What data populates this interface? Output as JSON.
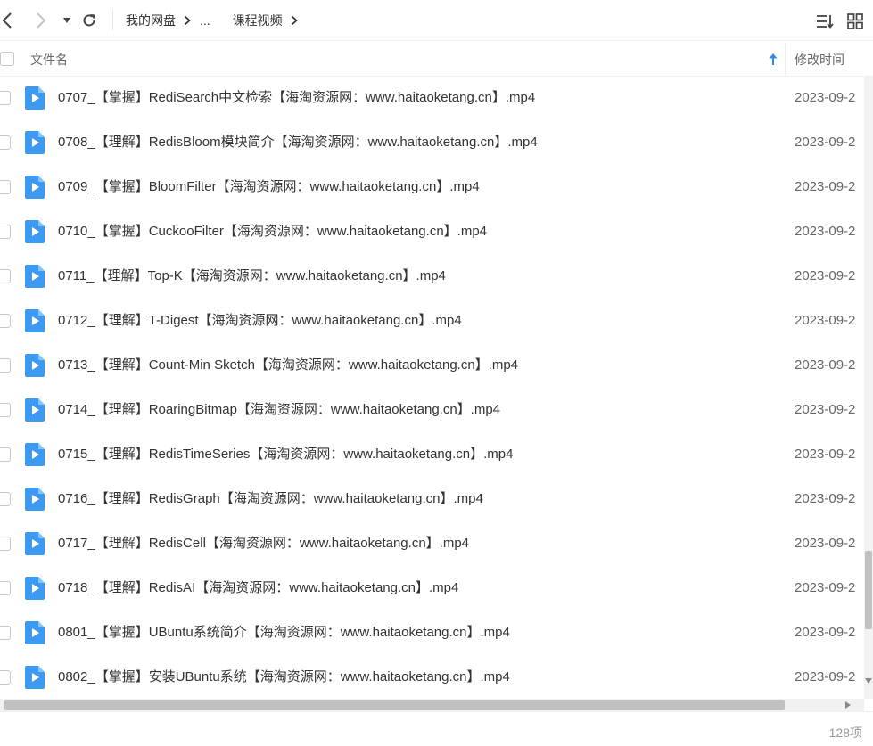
{
  "toolbar": {
    "icons": {
      "back": "chevron-left-icon",
      "forward": "chevron-right-icon",
      "history": "caret-down-icon",
      "refresh": "refresh-icon",
      "sort": "sort-list-icon",
      "view": "grid-view-icon"
    },
    "breadcrumb": {
      "root": "我的网盘",
      "ellipsis": "...",
      "current": "课程视频"
    }
  },
  "header": {
    "name_label": "文件名",
    "time_label": "修改时间",
    "sort_icon": "arrow-up-icon"
  },
  "files": [
    {
      "name": "0707_【掌握】RediSearch中文检索【海淘资源网：www.haitaoketang.cn】.mp4",
      "time": "2023-09-2"
    },
    {
      "name": "0708_【理解】RedisBloom模块简介【海淘资源网：www.haitaoketang.cn】.mp4",
      "time": "2023-09-2"
    },
    {
      "name": "0709_【掌握】BloomFilter【海淘资源网：www.haitaoketang.cn】.mp4",
      "time": "2023-09-2"
    },
    {
      "name": "0710_【掌握】CuckooFilter【海淘资源网：www.haitaoketang.cn】.mp4",
      "time": "2023-09-2"
    },
    {
      "name": "0711_【理解】Top-K【海淘资源网：www.haitaoketang.cn】.mp4",
      "time": "2023-09-2"
    },
    {
      "name": "0712_【理解】T-Digest【海淘资源网：www.haitaoketang.cn】.mp4",
      "time": "2023-09-2"
    },
    {
      "name": "0713_【理解】Count-Min Sketch【海淘资源网：www.haitaoketang.cn】.mp4",
      "time": "2023-09-2"
    },
    {
      "name": "0714_【理解】RoaringBitmap【海淘资源网：www.haitaoketang.cn】.mp4",
      "time": "2023-09-2"
    },
    {
      "name": "0715_【理解】RedisTimeSeries【海淘资源网：www.haitaoketang.cn】.mp4",
      "time": "2023-09-2"
    },
    {
      "name": "0716_【理解】RedisGraph【海淘资源网：www.haitaoketang.cn】.mp4",
      "time": "2023-09-2"
    },
    {
      "name": "0717_【理解】RedisCell【海淘资源网：www.haitaoketang.cn】.mp4",
      "time": "2023-09-2"
    },
    {
      "name": "0718_【理解】RedisAI【海淘资源网：www.haitaoketang.cn】.mp4",
      "time": "2023-09-2"
    },
    {
      "name": "0801_【掌握】UBuntu系统简介【海淘资源网：www.haitaoketang.cn】.mp4",
      "time": "2023-09-2"
    },
    {
      "name": "0802_【掌握】安装UBuntu系统【海淘资源网：www.haitaoketang.cn】.mp4",
      "time": "2023-09-2"
    }
  ],
  "file_icon": "video-file-icon",
  "status": {
    "count": "128项"
  },
  "colors": {
    "accent": "#2f8cf0",
    "file_icon": "#3c9af3",
    "text": "#333333",
    "muted": "#666666"
  }
}
